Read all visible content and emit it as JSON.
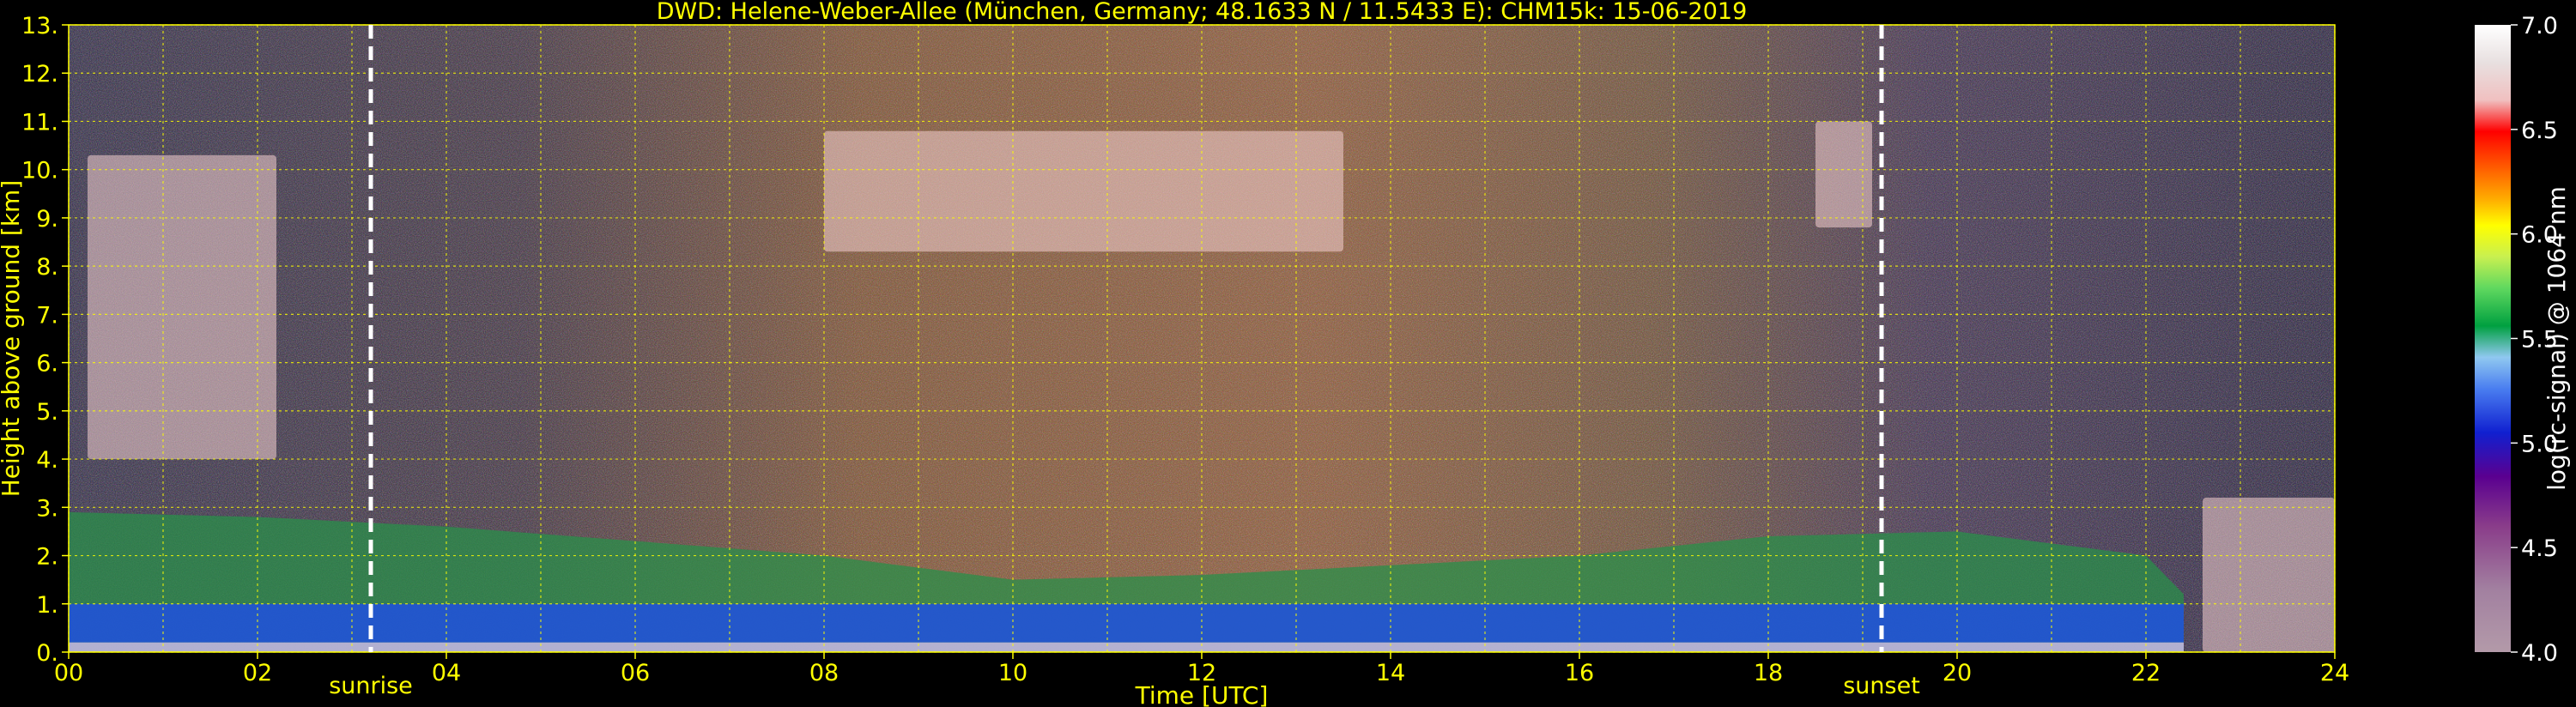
{
  "chart_data": {
    "type": "heatmap",
    "title": "DWD: Helene-Weber-Allee (München, Germany; 48.1633 N / 11.5433 E):    CHM15k: 15-06-2019",
    "xlabel": "Time [UTC]",
    "ylabel": "Height above ground [km]",
    "xlim": [
      0,
      24
    ],
    "ylim": [
      0,
      13
    ],
    "x_ticks": [
      "00",
      "02",
      "04",
      "06",
      "08",
      "10",
      "12",
      "14",
      "16",
      "18",
      "20",
      "22",
      "24"
    ],
    "y_ticks": [
      "0.",
      "1.",
      "2.",
      "3.",
      "4.",
      "5.",
      "6.",
      "7.",
      "8.",
      "9.",
      "10.",
      "11.",
      "12.",
      "13."
    ],
    "grid": true,
    "colorbar": {
      "label": "log(rc-signal) @ 1064 nm",
      "range": [
        4.0,
        7.0
      ],
      "ticks": [
        "4.0",
        "4.5",
        "5.0",
        "5.5",
        "6.0",
        "6.5",
        "7.0"
      ]
    },
    "events": [
      {
        "label": "sunrise",
        "time": 3.2
      },
      {
        "label": "sunset",
        "time": 19.2
      }
    ],
    "layers": [
      {
        "feature": "boundary layer top",
        "times": [
          0,
          2,
          4,
          6,
          8,
          10,
          12,
          14,
          16,
          18,
          20,
          22,
          22.4
        ],
        "heights": [
          2.9,
          2.8,
          2.6,
          2.3,
          2.0,
          1.5,
          1.6,
          1.8,
          2.0,
          2.4,
          2.5,
          2.0,
          1.2
        ]
      },
      {
        "feature": "high cirrus",
        "time_range": [
          8,
          13.5
        ],
        "height_range": [
          8.3,
          10.8
        ]
      },
      {
        "feature": "cirrus near sunset",
        "time_range": [
          18.5,
          19.1
        ],
        "height_range": [
          8.8,
          11.0
        ]
      },
      {
        "feature": "mid-level cloud",
        "time_range": [
          0.2,
          2.2
        ],
        "height_range": [
          4.0,
          10.3
        ]
      },
      {
        "feature": "late evening low cloud",
        "time_range": [
          22.6,
          24
        ],
        "height_range": [
          0,
          3.2
        ]
      }
    ]
  }
}
